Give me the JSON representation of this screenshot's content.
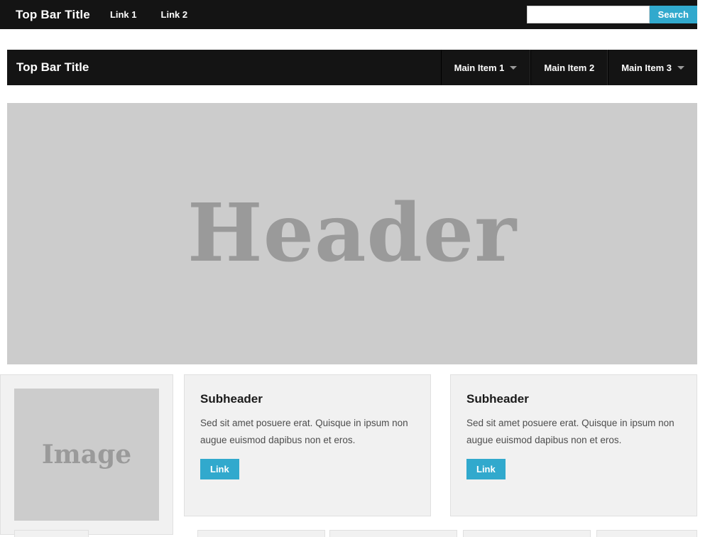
{
  "topbar": {
    "brand": "Top Bar Title",
    "links": [
      {
        "label": "Link 1"
      },
      {
        "label": "Link 2"
      }
    ],
    "search": {
      "value": "",
      "placeholder": "",
      "button_label": "Search"
    }
  },
  "navbar": {
    "brand": "Top Bar Title",
    "items": [
      {
        "label": "Main Item 1",
        "has_caret": true
      },
      {
        "label": "Main Item 2",
        "has_caret": false
      },
      {
        "label": "Main Item 3",
        "has_caret": true
      }
    ]
  },
  "header": {
    "title": "Header"
  },
  "content": {
    "image_panel": {
      "placeholder_label": "Image"
    },
    "cards": [
      {
        "title": "Subheader",
        "body": "Sed sit amet posuere erat. Quisque in ipsum non augue euismod dapibus non et eros.",
        "button_label": "Link"
      },
      {
        "title": "Subheader",
        "body": "Sed sit amet posuere erat. Quisque in ipsum non augue euismod dapibus non et eros.",
        "button_label": "Link"
      }
    ]
  },
  "colors": {
    "bar_background": "#141414",
    "accent_blue": "#31a9cd",
    "banner_gray": "#cccccc",
    "banner_text_gray": "#9a9a9a",
    "well_background": "#f1f1f1",
    "well_border": "#e0e0e0"
  }
}
